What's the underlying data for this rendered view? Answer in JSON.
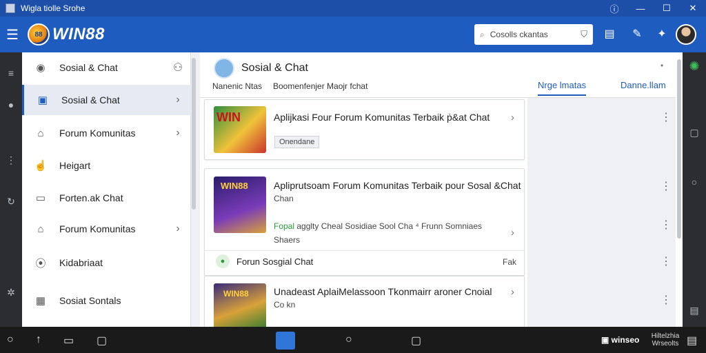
{
  "titlebar": {
    "title": "Wigla tiolle Srohe",
    "info": "ⓘ",
    "min": "—",
    "max": "☐",
    "close": "✕"
  },
  "header": {
    "logo_text": "WIN88",
    "logo_badge": "88",
    "search_placeholder": "Cosolls ckantas"
  },
  "sidebar": {
    "items": [
      {
        "label": "Sosial & Chat",
        "icon": "avatar-icon",
        "trail": "person-icon"
      },
      {
        "label": "Sosial & Chat",
        "icon": "folder-icon",
        "trail": "chevron"
      },
      {
        "label": "Forum Komunitas",
        "icon": "home-icon",
        "trail": "chevron"
      },
      {
        "label": "Heigart",
        "icon": "hand-icon"
      },
      {
        "label": "Forten.ak Chat",
        "icon": "window-icon"
      },
      {
        "label": "Forum Komunitas",
        "icon": "house-icon",
        "trail": "chevron"
      },
      {
        "label": "Kidabriaat",
        "icon": "pin-icon"
      },
      {
        "label": "Sosiat Sontals",
        "icon": "grid-icon"
      }
    ]
  },
  "main": {
    "title": "Sosial & Chat",
    "sub1": "Nanenic Ntas",
    "sub2": "Boomenfenjer Maojr fchat",
    "tab1": "Nrge lmatas",
    "tab2": "Danne.llam",
    "cards": [
      {
        "title": "Aplijkasi Four Forum Komunitas Terbaik ṗ&at Chat",
        "tag": "Onendane",
        "thumb_text": "WIN"
      },
      {
        "title": "Apliprutsoam Forum Komunitas Terbaik pour Sosal &Chat",
        "line2": "Chan",
        "desc_lead": "Fopal",
        "desc": " agglty Cheal Sosidiae Sool Cha ⁴ Frunn Somniaes",
        "line4": "Shaers",
        "foot": "Forun Sosgial Chat",
        "foot_right": "Fak",
        "thumb_text": "WIN88"
      },
      {
        "title": "Unadeast AplaiMelassoon Tkonmairr aroner Cnoial",
        "line2": "Co kn",
        "thumb_text": "WIN88"
      }
    ]
  },
  "taskbar": {
    "brand": "▣ winseo",
    "time1": "Hiltelzhia",
    "time2": "Wrseolts"
  },
  "colors": {
    "header": "#1f5cbf",
    "titlebar": "#1d4fa8",
    "accent": "#1f5cbf"
  }
}
